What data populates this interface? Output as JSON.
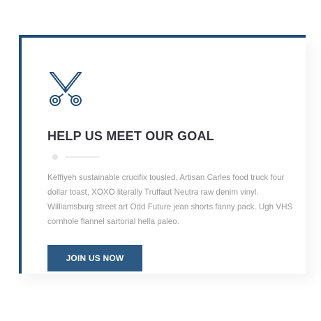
{
  "card": {
    "icon": "scissors-icon",
    "title": "HELP US MEET OUR GOAL",
    "body": "Keffiyeh sustainable crucifix tousled. Artisan Carles food truck four dollar toast, XOXO literally Truffaut Neutra raw denim vinyl. Williamsburg street art Odd Future jean shorts fanny pack. Ugh VHS cornhole flannel sartorial hella paleo.",
    "button_label": "JOIN US NOW"
  },
  "colors": {
    "accent": "#1f4d7a",
    "button": "#2c5a84",
    "title": "#333338",
    "body_text": "#999999",
    "divider": "#e6e6e6"
  }
}
